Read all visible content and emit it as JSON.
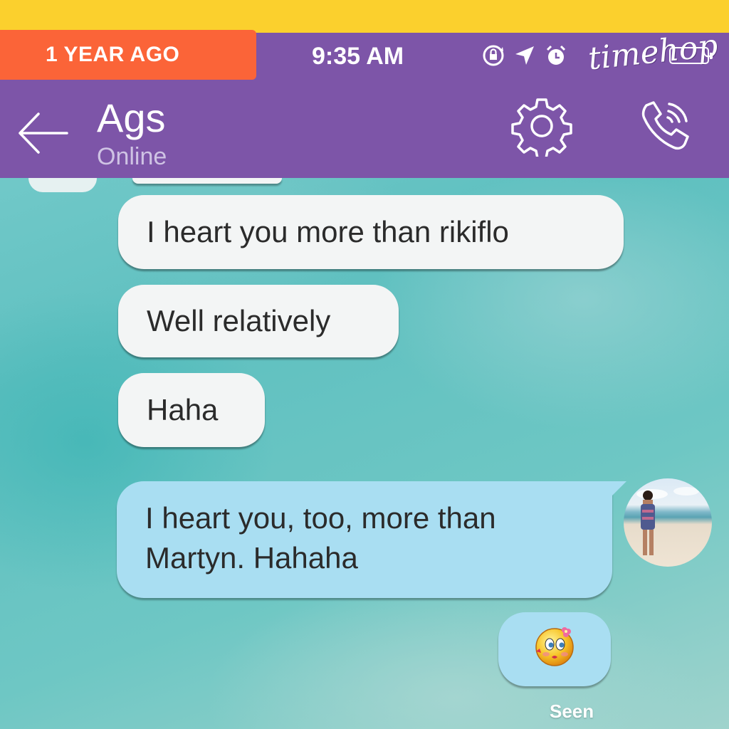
{
  "banner": {
    "label": "1 YEAR AGO",
    "brand": "timehop"
  },
  "status_bar": {
    "time": "9:35 AM"
  },
  "header": {
    "contact_name": "Ags",
    "contact_status": "Online"
  },
  "messages": [
    {
      "direction": "incoming",
      "text": "I heart you more than rikiflo"
    },
    {
      "direction": "incoming",
      "text": "Well relatively"
    },
    {
      "direction": "incoming",
      "text": "Haha"
    },
    {
      "direction": "outgoing",
      "text": "I heart you, too, more than Martyn. Hahaha"
    },
    {
      "direction": "outgoing",
      "sticker": "kiss-emoji-sticker"
    }
  ],
  "receipt": "Seen",
  "colors": {
    "top_band": "#fbd02d",
    "header_purple": "#7d55a8",
    "badge_orange": "#fb6438",
    "incoming_bubble": "#f3f5f5",
    "outgoing_bubble": "#a9def2"
  }
}
